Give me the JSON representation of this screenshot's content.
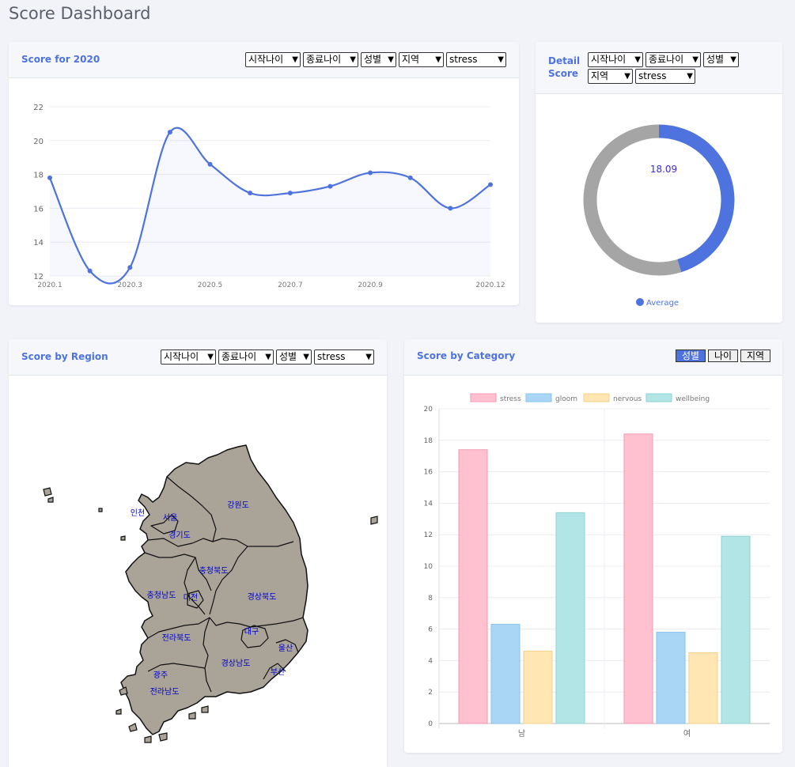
{
  "page_title": "Score Dashboard",
  "filters": {
    "start_age": "시작나이",
    "end_age": "종료나이",
    "gender": "성별",
    "region": "지역",
    "metric": "stress"
  },
  "line_card": {
    "title": "Score for 2020"
  },
  "detail_card": {
    "title_line1": "Detail",
    "title_line2": "Score",
    "value": "18.09",
    "legend": "Average"
  },
  "region_card": {
    "title": "Score by Region",
    "labels": [
      "인천",
      "서울",
      "강원도",
      "경기도",
      "충청북도",
      "충청남도",
      "대전",
      "경상북도",
      "대구",
      "전라북도",
      "울산",
      "경상남도",
      "광주",
      "부산",
      "전라남도"
    ]
  },
  "category_card": {
    "title": "Score by Category",
    "toggles": [
      "성별",
      "나이",
      "지역"
    ],
    "active_toggle": "성별"
  },
  "colors": {
    "accent": "#4e73df",
    "donut_rest": "#a5a5a5"
  },
  "chart_data": [
    {
      "type": "line",
      "x": [
        "2020.1",
        "2020.2",
        "2020.3",
        "2020.4",
        "2020.5",
        "2020.6",
        "2020.7",
        "2020.8",
        "2020.9",
        "2020.10",
        "2020.11",
        "2020.12"
      ],
      "x_tick_labels": [
        "2020.1",
        "2020.3",
        "2020.5",
        "2020.7",
        "2020.9",
        "2020.12"
      ],
      "values": [
        17.8,
        12.3,
        12.5,
        20.5,
        18.6,
        16.9,
        16.9,
        17.3,
        18.1,
        17.8,
        16.0,
        17.4
      ],
      "ylim": [
        12,
        22
      ],
      "y_ticks": [
        12,
        14,
        16,
        18,
        20,
        22
      ],
      "grid": true
    },
    {
      "type": "pie",
      "values": [
        18.09,
        21.91
      ],
      "labels": [
        "Average",
        ""
      ],
      "legend_position": "bottom"
    },
    {
      "type": "bar",
      "categories": [
        "남",
        "여"
      ],
      "series": [
        {
          "name": "stress",
          "values": [
            17.4,
            18.4
          ],
          "color": "#ffc1d0",
          "border": "#f29ab0"
        },
        {
          "name": "gloom",
          "values": [
            6.3,
            5.8
          ],
          "color": "#a9d6f5",
          "border": "#86c2ec"
        },
        {
          "name": "nervous",
          "values": [
            4.6,
            4.5
          ],
          "color": "#ffe6b3",
          "border": "#f6d28a"
        },
        {
          "name": "wellbeing",
          "values": [
            13.4,
            11.9
          ],
          "color": "#b2e5e5",
          "border": "#8fd3d3"
        }
      ],
      "ylim": [
        0,
        20
      ],
      "y_ticks": [
        0,
        2,
        4,
        6,
        8,
        10,
        12,
        14,
        16,
        18,
        20
      ],
      "legend_position": "top",
      "grid": true
    }
  ]
}
